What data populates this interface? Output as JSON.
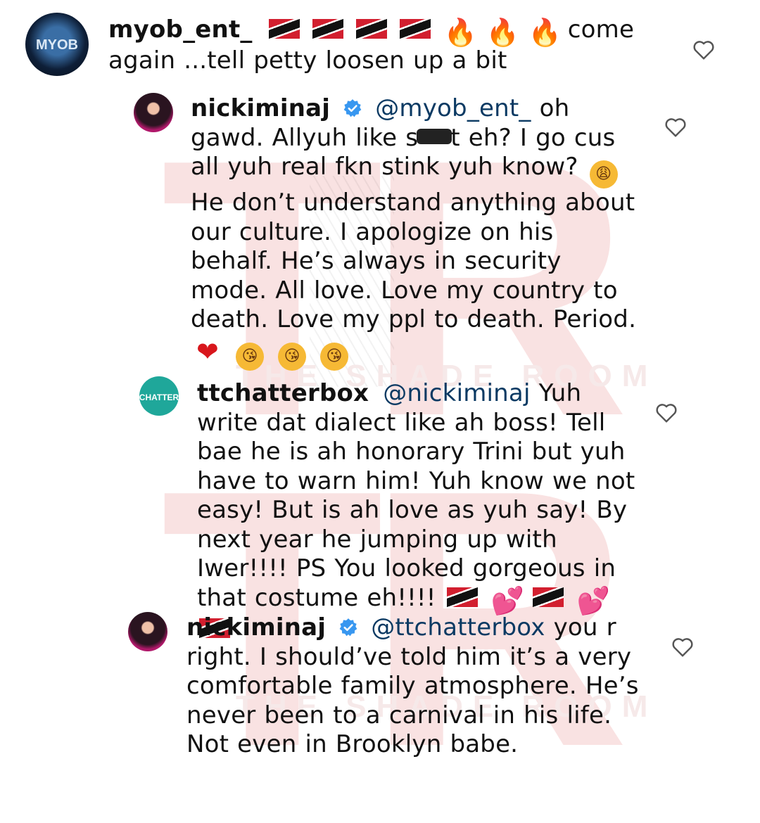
{
  "watermark": {
    "letter_top": "T",
    "letter_right": "R",
    "letter_bottom": "T",
    "letter_bottom_right": "R",
    "brand_1": "THE SHADE ROOM",
    "brand_2": "THE SHADE ROOM"
  },
  "comments": [
    {
      "avatar_label": "MYOB",
      "username": "myob_ent_",
      "text_after_emojis": "come again ...tell petty loosen up a bit",
      "emojis": [
        "trinidad-flag",
        "trinidad-flag",
        "trinidad-flag",
        "trinidad-flag",
        "fire",
        "fire",
        "fire"
      ]
    },
    {
      "username": "nickiminaj",
      "mention": "@myob_ent_",
      "text_1": "oh gawd. Allyuh like s",
      "text_2": "t eh? I go cus all yuh real fkn stink yuh know?",
      "text_3": "He don’t understand anything about our culture. I apologize on his behalf. He’s always in security mode. All love. Love my country to death. Love my ppl to death. Period."
    },
    {
      "avatar_label": "CHATTER",
      "username": "ttchatterbox",
      "mention": "@nickiminaj",
      "text": "Yuh write dat dialect like ah boss! Tell bae he is ah honorary Trini but yuh have to warn him! Yuh know we not easy! But is ah love as yuh say! By next year he jumping up with Iwer!!!! PS You looked gorgeous in that costume eh!!!!"
    },
    {
      "username": "nickiminaj",
      "mention": "@ttchatterbox",
      "text": "you r right. I should’ve told him it’s a very comfortable family atmosphere. He’s never been to a carnival in his life. Not even in Brooklyn babe."
    }
  ],
  "icons": {
    "fire": "🔥",
    "two_hearts": "💕",
    "red_heart": "❤",
    "weary_face": "😩",
    "kiss_face": "😘"
  }
}
